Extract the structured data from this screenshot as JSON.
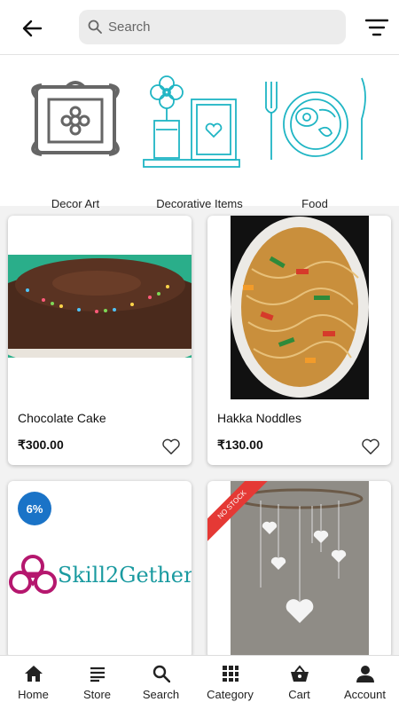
{
  "header": {
    "search_placeholder": "Search",
    "back_icon": "arrow-left-icon",
    "filter_icon": "filter-icon"
  },
  "categories": [
    {
      "label": "Decor Art",
      "icon": "framed-flower-icon"
    },
    {
      "label": "Decorative Items",
      "icon": "flower-vase-frame-icon"
    },
    {
      "label": "Food",
      "icon": "plate-fork-knife-icon"
    }
  ],
  "products": [
    {
      "name": "Chocolate Cake",
      "price": "₹300.00"
    },
    {
      "name": "Hakka Noddles",
      "price": "₹130.00"
    },
    {
      "badge": "6%",
      "brand": "Skill2Gether"
    },
    {
      "ribbon": "NO STOCK"
    }
  ],
  "nav": [
    {
      "label": "Home",
      "icon": "home-icon"
    },
    {
      "label": "Store",
      "icon": "list-icon"
    },
    {
      "label": "Search",
      "icon": "search-icon"
    },
    {
      "label": "Category",
      "icon": "grid-icon"
    },
    {
      "label": "Cart",
      "icon": "basket-icon"
    },
    {
      "label": "Account",
      "icon": "person-icon"
    }
  ],
  "colors": {
    "accent_teal": "#1fb5c4",
    "badge_blue": "#1a73c7",
    "ribbon_red": "#e53935",
    "brand_magenta": "#b5176e",
    "brand_teal": "#1a9aa0"
  }
}
